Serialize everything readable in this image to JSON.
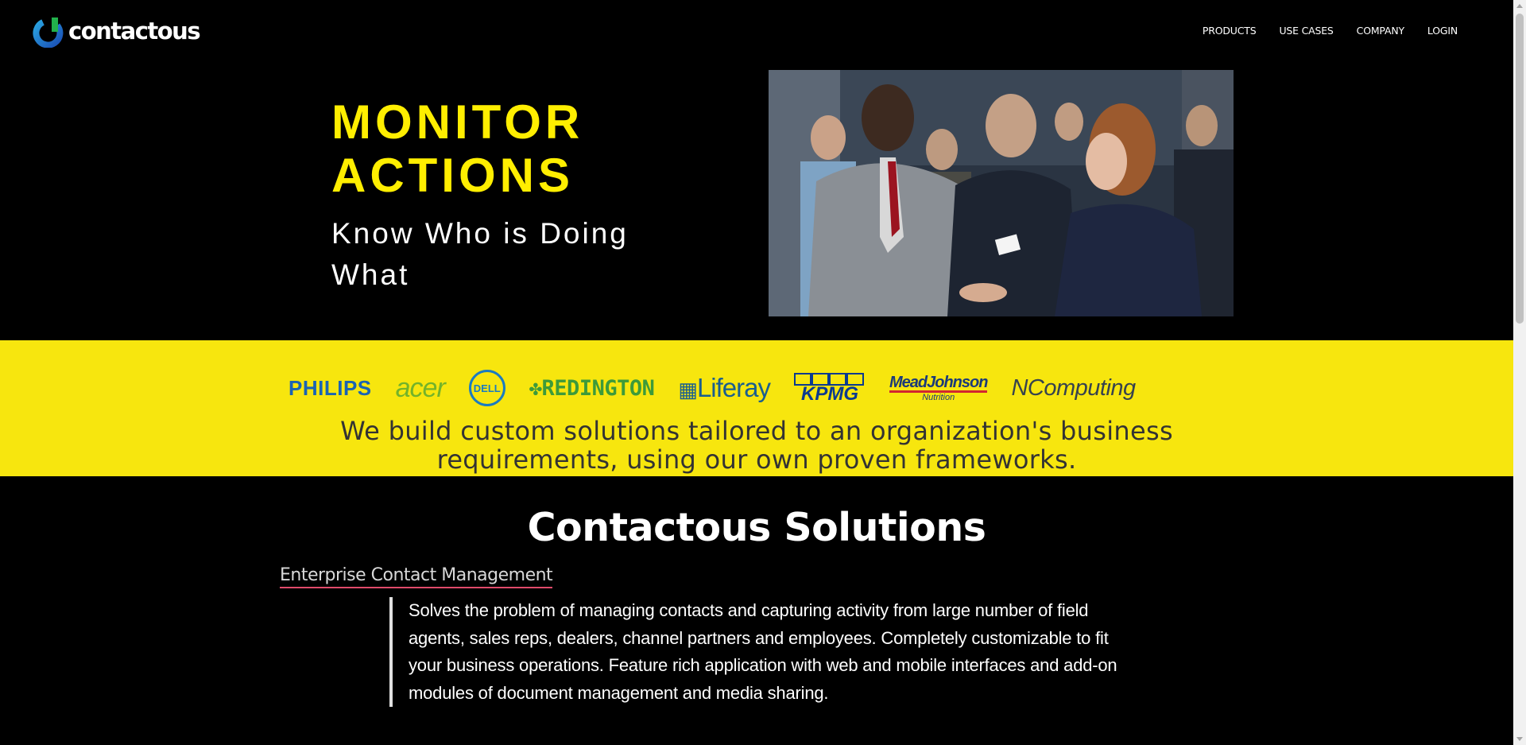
{
  "brand": {
    "name": "contactous"
  },
  "nav": {
    "items": [
      "PRODUCTS",
      "USE CASES",
      "COMPANY",
      "LOGIN"
    ]
  },
  "hero": {
    "title_line1": "MONITOR",
    "title_line2": "ACTIONS",
    "subtitle": "Know Who is Doing What",
    "image_alt": "business-handshake-photo"
  },
  "clients": {
    "logos": [
      "PHILIPS",
      "acer",
      "DELL",
      "REDINGTON",
      "Liferay",
      "KPMG",
      "MeadJohnson",
      "Nutrition",
      "NComputing"
    ],
    "tagline": "We build custom solutions tailored to an organization's business requirements, using our own proven frameworks."
  },
  "solutions": {
    "title": "Contactous Solutions",
    "item1_title": "Enterprise Contact Management",
    "item1_desc": "Solves the problem of managing contacts and capturing activity from large number of field agents, sales reps, dealers, channel partners and employees. Completely customizable to fit your business operations. Feature rich application with web and mobile interfaces and add-on modules of document management and media sharing."
  },
  "colors": {
    "accent_yellow": "#f7e60e",
    "hero_title": "#ffee00",
    "link_underline": "#e04a6a",
    "background": "#000000"
  }
}
